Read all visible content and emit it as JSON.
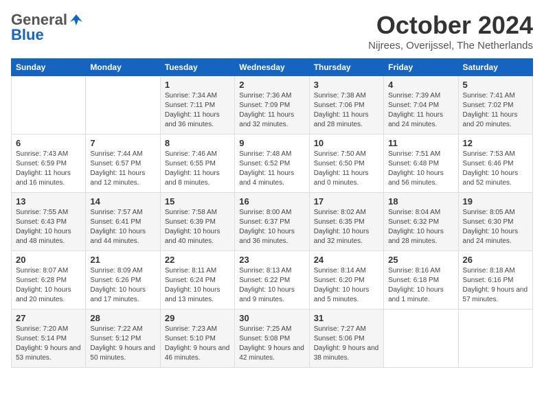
{
  "logo": {
    "general": "General",
    "blue": "Blue"
  },
  "header": {
    "month": "October 2024",
    "location": "Nijrees, Overijssel, The Netherlands"
  },
  "weekdays": [
    "Sunday",
    "Monday",
    "Tuesday",
    "Wednesday",
    "Thursday",
    "Friday",
    "Saturday"
  ],
  "weeks": [
    [
      {
        "day": "",
        "detail": ""
      },
      {
        "day": "",
        "detail": ""
      },
      {
        "day": "1",
        "detail": "Sunrise: 7:34 AM\nSunset: 7:11 PM\nDaylight: 11 hours\nand 36 minutes."
      },
      {
        "day": "2",
        "detail": "Sunrise: 7:36 AM\nSunset: 7:09 PM\nDaylight: 11 hours\nand 32 minutes."
      },
      {
        "day": "3",
        "detail": "Sunrise: 7:38 AM\nSunset: 7:06 PM\nDaylight: 11 hours\nand 28 minutes."
      },
      {
        "day": "4",
        "detail": "Sunrise: 7:39 AM\nSunset: 7:04 PM\nDaylight: 11 hours\nand 24 minutes."
      },
      {
        "day": "5",
        "detail": "Sunrise: 7:41 AM\nSunset: 7:02 PM\nDaylight: 11 hours\nand 20 minutes."
      }
    ],
    [
      {
        "day": "6",
        "detail": "Sunrise: 7:43 AM\nSunset: 6:59 PM\nDaylight: 11 hours\nand 16 minutes."
      },
      {
        "day": "7",
        "detail": "Sunrise: 7:44 AM\nSunset: 6:57 PM\nDaylight: 11 hours\nand 12 minutes."
      },
      {
        "day": "8",
        "detail": "Sunrise: 7:46 AM\nSunset: 6:55 PM\nDaylight: 11 hours\nand 8 minutes."
      },
      {
        "day": "9",
        "detail": "Sunrise: 7:48 AM\nSunset: 6:52 PM\nDaylight: 11 hours\nand 4 minutes."
      },
      {
        "day": "10",
        "detail": "Sunrise: 7:50 AM\nSunset: 6:50 PM\nDaylight: 11 hours\nand 0 minutes."
      },
      {
        "day": "11",
        "detail": "Sunrise: 7:51 AM\nSunset: 6:48 PM\nDaylight: 10 hours\nand 56 minutes."
      },
      {
        "day": "12",
        "detail": "Sunrise: 7:53 AM\nSunset: 6:46 PM\nDaylight: 10 hours\nand 52 minutes."
      }
    ],
    [
      {
        "day": "13",
        "detail": "Sunrise: 7:55 AM\nSunset: 6:43 PM\nDaylight: 10 hours\nand 48 minutes."
      },
      {
        "day": "14",
        "detail": "Sunrise: 7:57 AM\nSunset: 6:41 PM\nDaylight: 10 hours\nand 44 minutes."
      },
      {
        "day": "15",
        "detail": "Sunrise: 7:58 AM\nSunset: 6:39 PM\nDaylight: 10 hours\nand 40 minutes."
      },
      {
        "day": "16",
        "detail": "Sunrise: 8:00 AM\nSunset: 6:37 PM\nDaylight: 10 hours\nand 36 minutes."
      },
      {
        "day": "17",
        "detail": "Sunrise: 8:02 AM\nSunset: 6:35 PM\nDaylight: 10 hours\nand 32 minutes."
      },
      {
        "day": "18",
        "detail": "Sunrise: 8:04 AM\nSunset: 6:32 PM\nDaylight: 10 hours\nand 28 minutes."
      },
      {
        "day": "19",
        "detail": "Sunrise: 8:05 AM\nSunset: 6:30 PM\nDaylight: 10 hours\nand 24 minutes."
      }
    ],
    [
      {
        "day": "20",
        "detail": "Sunrise: 8:07 AM\nSunset: 6:28 PM\nDaylight: 10 hours\nand 20 minutes."
      },
      {
        "day": "21",
        "detail": "Sunrise: 8:09 AM\nSunset: 6:26 PM\nDaylight: 10 hours\nand 17 minutes."
      },
      {
        "day": "22",
        "detail": "Sunrise: 8:11 AM\nSunset: 6:24 PM\nDaylight: 10 hours\nand 13 minutes."
      },
      {
        "day": "23",
        "detail": "Sunrise: 8:13 AM\nSunset: 6:22 PM\nDaylight: 10 hours\nand 9 minutes."
      },
      {
        "day": "24",
        "detail": "Sunrise: 8:14 AM\nSunset: 6:20 PM\nDaylight: 10 hours\nand 5 minutes."
      },
      {
        "day": "25",
        "detail": "Sunrise: 8:16 AM\nSunset: 6:18 PM\nDaylight: 10 hours\nand 1 minute."
      },
      {
        "day": "26",
        "detail": "Sunrise: 8:18 AM\nSunset: 6:16 PM\nDaylight: 9 hours\nand 57 minutes."
      }
    ],
    [
      {
        "day": "27",
        "detail": "Sunrise: 7:20 AM\nSunset: 5:14 PM\nDaylight: 9 hours\nand 53 minutes."
      },
      {
        "day": "28",
        "detail": "Sunrise: 7:22 AM\nSunset: 5:12 PM\nDaylight: 9 hours\nand 50 minutes."
      },
      {
        "day": "29",
        "detail": "Sunrise: 7:23 AM\nSunset: 5:10 PM\nDaylight: 9 hours\nand 46 minutes."
      },
      {
        "day": "30",
        "detail": "Sunrise: 7:25 AM\nSunset: 5:08 PM\nDaylight: 9 hours\nand 42 minutes."
      },
      {
        "day": "31",
        "detail": "Sunrise: 7:27 AM\nSunset: 5:06 PM\nDaylight: 9 hours\nand 38 minutes."
      },
      {
        "day": "",
        "detail": ""
      },
      {
        "day": "",
        "detail": ""
      }
    ]
  ]
}
